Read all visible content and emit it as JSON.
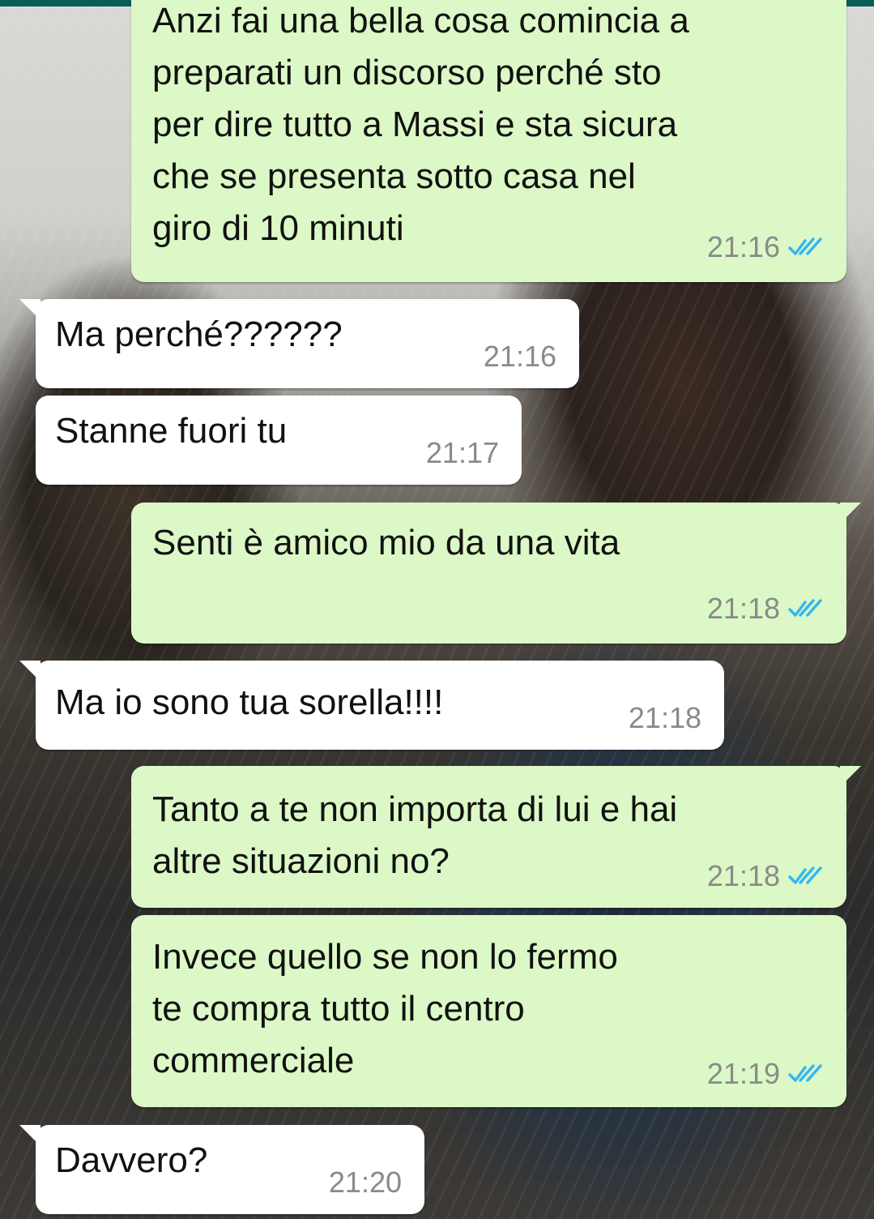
{
  "messages": [
    {
      "direction": "out",
      "text": "Anzi fai una bella cosa comincia a\npreparati un discorso perché sto\nper dire tutto a Massi e sta sicura\nche se presenta sotto casa nel\ngiro di 10 minuti",
      "time": "21:16",
      "status": "read"
    },
    {
      "direction": "in",
      "text": "Ma perché??????",
      "time": "21:16"
    },
    {
      "direction": "in",
      "text": "Stanne fuori tu",
      "time": "21:17"
    },
    {
      "direction": "out",
      "text": "Senti è amico mio da una vita",
      "time": "21:18",
      "status": "read"
    },
    {
      "direction": "in",
      "text": "Ma io sono tua sorella!!!!",
      "time": "21:18"
    },
    {
      "direction": "out",
      "text": "Tanto a te non importa di lui e hai\naltre situazioni no?",
      "time": "21:18",
      "status": "read"
    },
    {
      "direction": "out",
      "text": "Invece quello se non lo fermo\nte compra tutto il centro\ncommerciale",
      "time": "21:19",
      "status": "read"
    },
    {
      "direction": "in",
      "text": "Davvero?",
      "time": "21:20"
    }
  ],
  "colors": {
    "outgoing_bubble": "#dcf8c6",
    "incoming_bubble": "#ffffff",
    "timestamp": "#8a8a8a",
    "read_ticks": "#34b7f1",
    "header": "#075e54"
  },
  "icons": {
    "read_receipt": "double-check-icon"
  }
}
